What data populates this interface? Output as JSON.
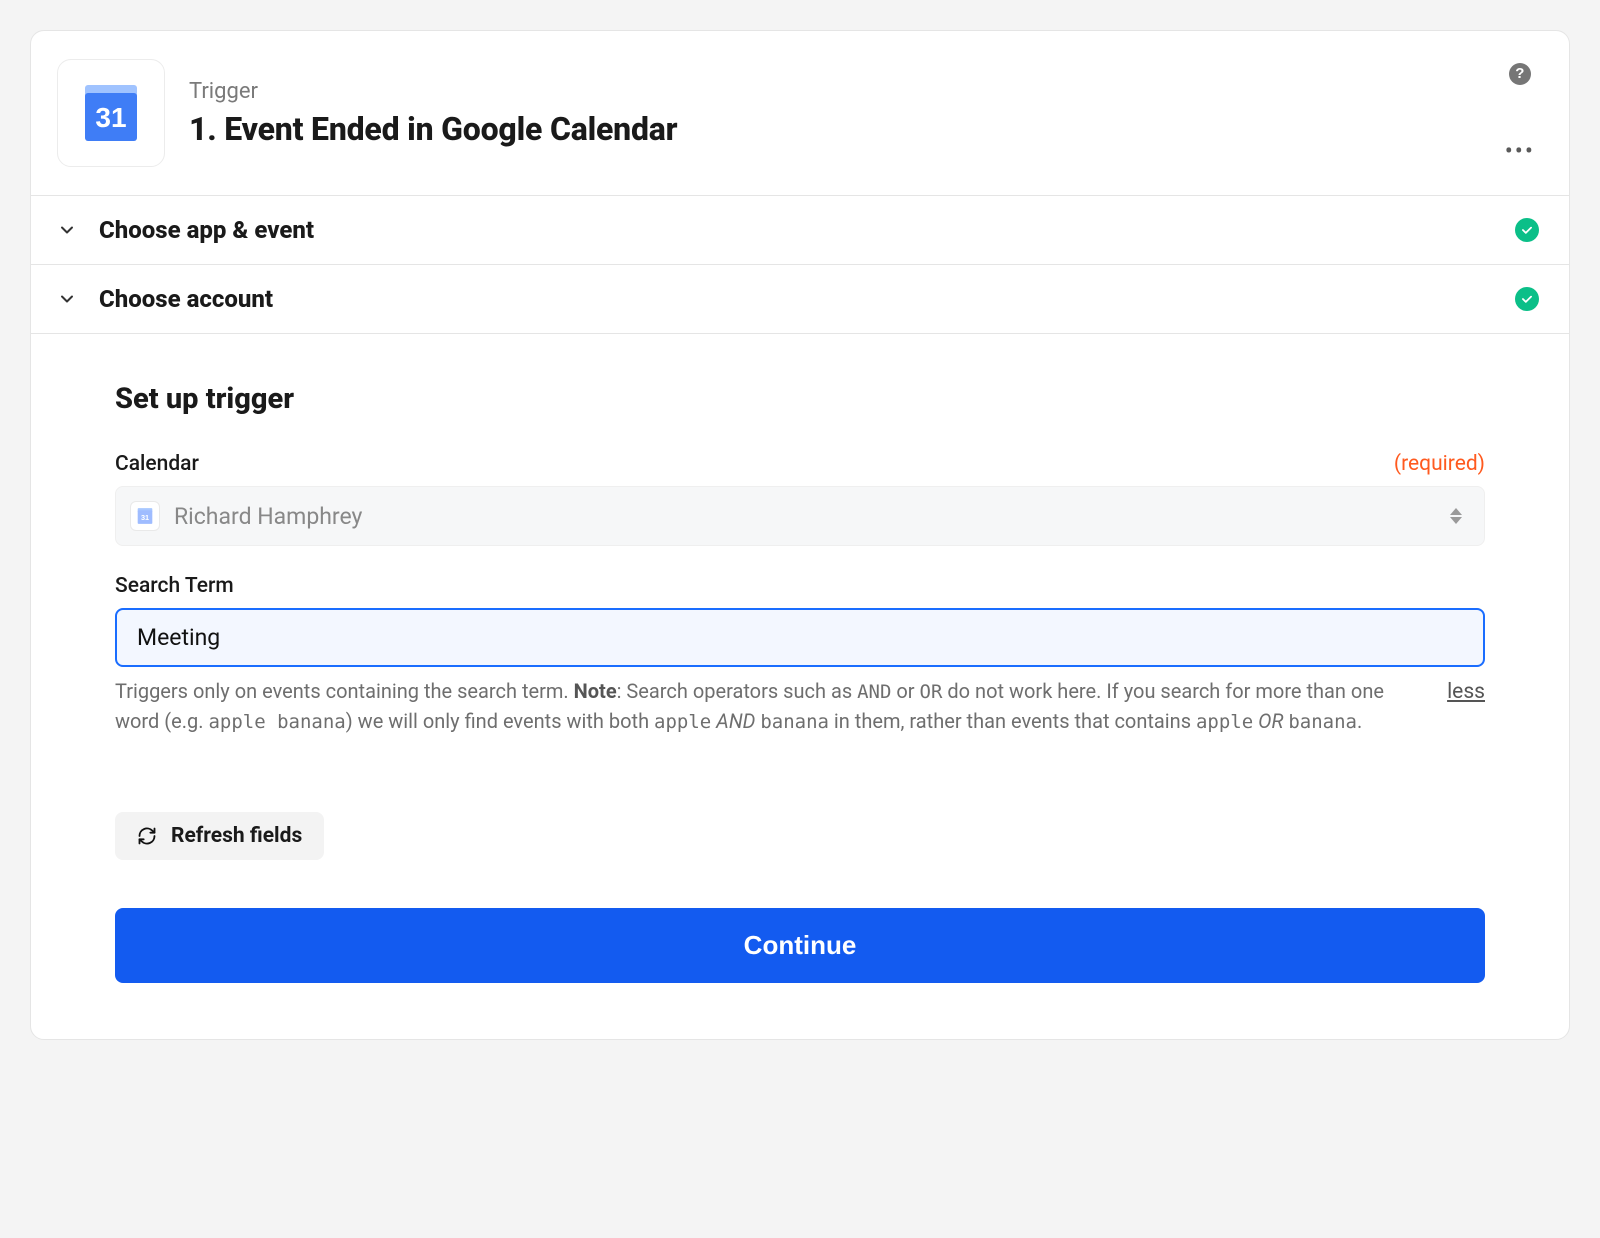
{
  "header": {
    "subtitle": "Trigger",
    "title": "1. Event Ended in Google Calendar",
    "app_icon_date": "31"
  },
  "sections": {
    "choose_app_event": {
      "label": "Choose app & event",
      "completed": true
    },
    "choose_account": {
      "label": "Choose account",
      "completed": true
    }
  },
  "setup": {
    "heading": "Set up trigger",
    "fields": {
      "calendar": {
        "label": "Calendar",
        "required_text": "(required)",
        "selected_value": "Richard Hamphrey"
      },
      "search_term": {
        "label": "Search Term",
        "value": "Meeting",
        "help": {
          "prefix": "Triggers only on events containing the search term. ",
          "note_bold": "Note",
          "after_note": ": Search operators such as ",
          "op_and": "AND",
          "or_word": " or ",
          "op_or": "OR",
          "after_ops": " do not work here. If you search for more than one word (e.g. ",
          "eg_code": "apple banana",
          "after_eg": ") we will only find events with both ",
          "ex_apple": "apple",
          "and_italic": " AND ",
          "ex_banana": "banana",
          "after_and": " in them, rather than events that contains ",
          "ex_apple2": "apple",
          "or_italic": " OR ",
          "ex_banana2": "banana",
          "tail": "."
        },
        "less_link": "less"
      }
    },
    "refresh_label": "Refresh fields",
    "continue_label": "Continue"
  }
}
